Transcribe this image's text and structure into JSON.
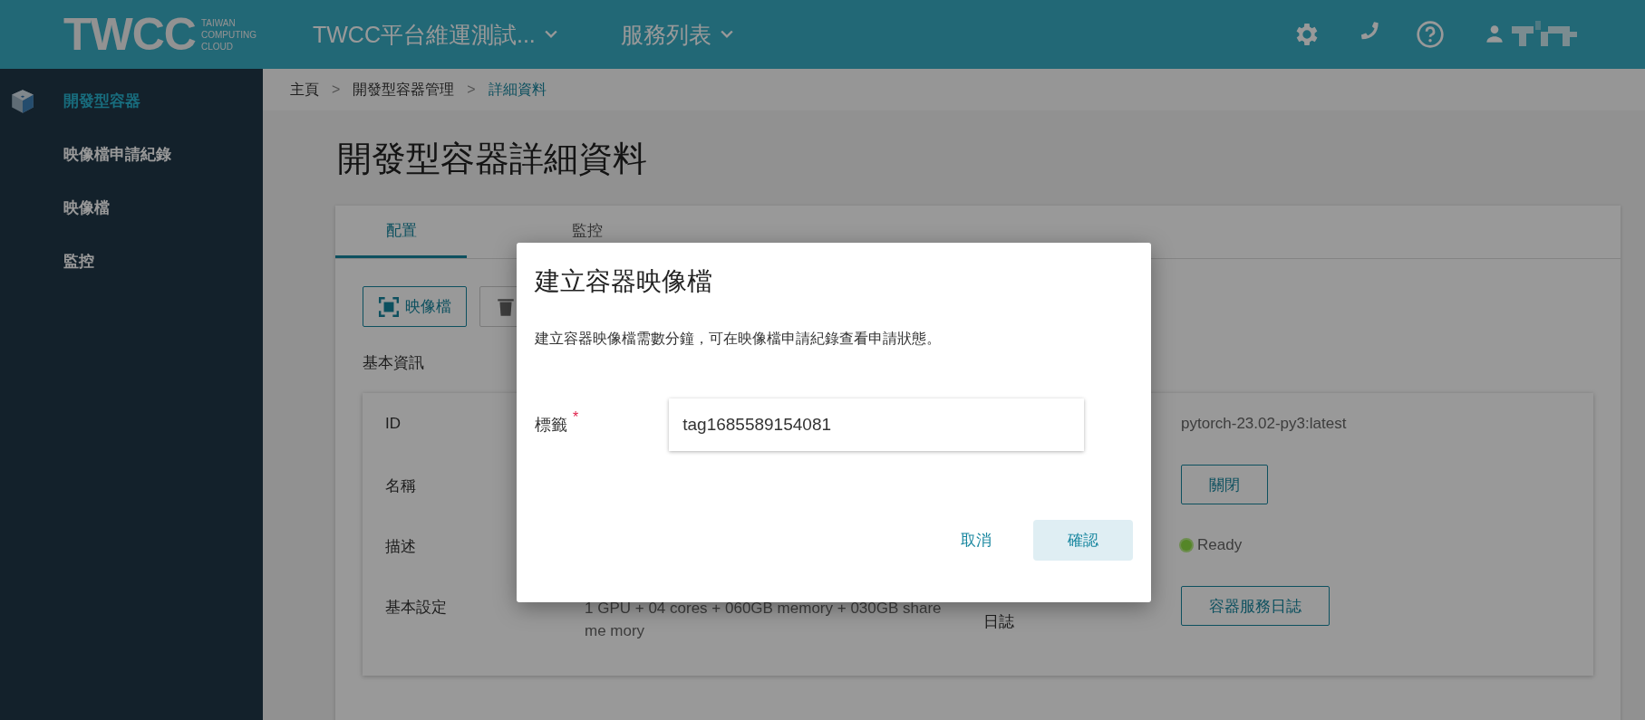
{
  "header": {
    "logo": {
      "mark": "TWCC",
      "tagline": [
        "TAIWAN",
        "COMPUTING",
        "CLOUD"
      ]
    },
    "menus": [
      {
        "label": "TWCC平台維運測試..."
      },
      {
        "label": "服務列表"
      }
    ]
  },
  "sidebar": {
    "items": [
      {
        "label": "開發型容器",
        "selected": true
      },
      {
        "label": "映像檔申請紀錄",
        "selected": false
      },
      {
        "label": "映像檔",
        "selected": false
      },
      {
        "label": "監控",
        "selected": false
      }
    ]
  },
  "breadcrumb": [
    {
      "label": "主頁",
      "current": false
    },
    {
      "label": "開發型容器管理",
      "current": false
    },
    {
      "label": "詳細資料",
      "current": true
    }
  ],
  "breadcrumb_separator": ">",
  "page_title": "開發型容器詳細資料",
  "tabs": [
    {
      "label": "配置",
      "selected": true
    },
    {
      "label": "監控",
      "selected": false
    }
  ],
  "toolbar": [
    {
      "label": "映像檔",
      "kind": "image"
    },
    {
      "kind": "delete"
    }
  ],
  "section_title": "基本資訊",
  "info_rows": [
    {
      "left": {
        "label": "ID"
      },
      "right": {
        "kind": "text",
        "value": "pytorch-23.02-py3:latest"
      }
    },
    {
      "left": {
        "label": "名稱"
      },
      "right": {
        "kind": "button",
        "value": "關閉"
      }
    },
    {
      "left": {
        "label": "描述"
      },
      "right": {
        "kind": "status",
        "value": "Ready"
      }
    },
    {
      "left": {
        "label": "基本設定",
        "value": "1 GPU + 04 cores + 060GB memory + 030GB share me mory"
      },
      "right": {
        "label": "日誌",
        "kind": "button",
        "value": "容器服務日誌"
      }
    }
  ],
  "dialog": {
    "title": "建立容器映像檔",
    "message": "建立容器映像檔需數分鐘，可在映像檔申請紀錄查看申請狀態。",
    "field": {
      "label": "標籤",
      "required_mark": "*",
      "value": "tag1685589154081"
    },
    "buttons": [
      {
        "label": "取消",
        "kind": "text"
      },
      {
        "label": "確認",
        "kind": "primary"
      }
    ]
  }
}
